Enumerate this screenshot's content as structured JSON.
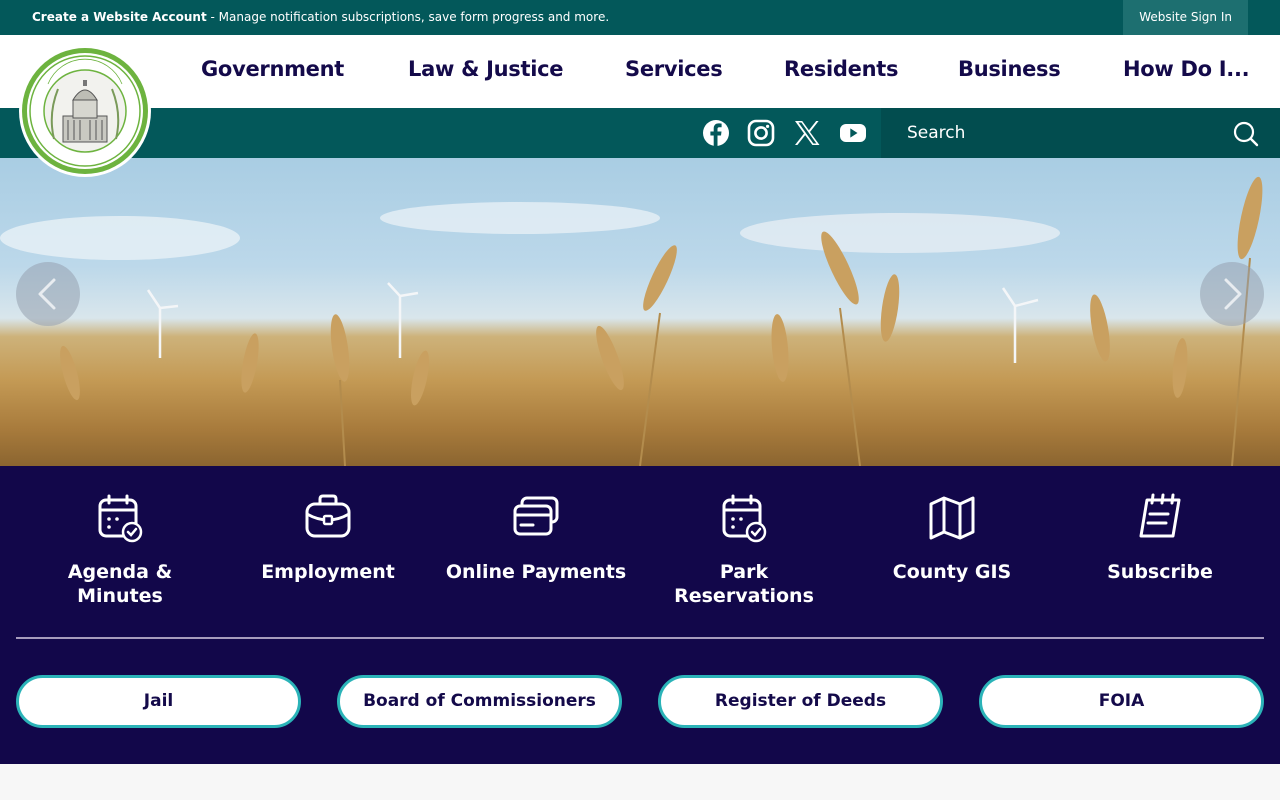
{
  "topbar": {
    "account_link": "Create a Website Account",
    "account_message": " - Manage notification subscriptions, save form progress and more.",
    "signin": "Website Sign In"
  },
  "logo": {
    "name": "Gratiot County Michigan seal"
  },
  "nav": {
    "items": [
      {
        "label": "Government"
      },
      {
        "label": "Law & Justice"
      },
      {
        "label": "Services"
      },
      {
        "label": "Residents"
      },
      {
        "label": "Business"
      },
      {
        "label": "How Do I..."
      }
    ]
  },
  "social": {
    "icons": [
      "facebook-icon",
      "instagram-icon",
      "x-icon",
      "youtube-icon"
    ]
  },
  "search": {
    "placeholder": "Search"
  },
  "quick_links": [
    {
      "label": "Agenda & Minutes",
      "icon": "calendar-check-icon"
    },
    {
      "label": "Employment",
      "icon": "briefcase-icon"
    },
    {
      "label": "Online Payments",
      "icon": "credit-cards-icon"
    },
    {
      "label": "Park Reservations",
      "icon": "calendar-check-icon"
    },
    {
      "label": "County GIS",
      "icon": "map-icon"
    },
    {
      "label": "Subscribe",
      "icon": "notepad-icon"
    }
  ],
  "buttons": [
    {
      "label": "Jail"
    },
    {
      "label": "Board of Commissioners"
    },
    {
      "label": "Register of Deeds"
    },
    {
      "label": "FOIA"
    }
  ],
  "colors": {
    "teal": "#03585a",
    "navy": "#12074a",
    "nav_text": "#140a4a",
    "pill_border": "#2bb3b8",
    "logo_green": "#6db33f"
  }
}
